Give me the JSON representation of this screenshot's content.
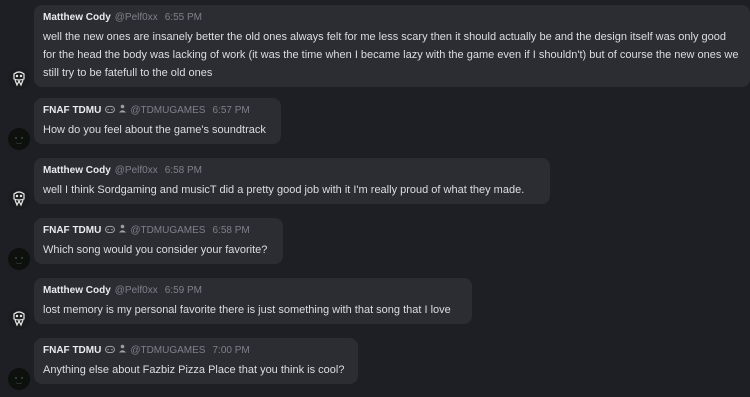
{
  "messages": [
    {
      "user": "Matthew Cody",
      "handle": "@Pelf0xx",
      "time": "6:55 PM",
      "avatar_icon": "skull-doodle-icon",
      "text": "well the new ones are insanely better the old ones always felt for me less scary then it should actually be and the design itself was only good for the head the body was lacking of work (it was the time when I became lazy with the game even if I shouldn't) but of course the new ones we still try to be fatefull to the old ones"
    },
    {
      "user": "FNAF TDMU",
      "handle": "@TDMUGAMES",
      "time": "6:57 PM",
      "avatar_icon": "dark-animatronic-icon",
      "badges": [
        "controller-badge-icon",
        "bot-badge-icon"
      ],
      "text": "How do you feel about the game's soundtrack"
    },
    {
      "user": "Matthew Cody",
      "handle": "@Pelf0xx",
      "time": "6:58 PM",
      "avatar_icon": "skull-doodle-icon",
      "text": "well I think Sordgaming and musicT did a pretty good job with it I'm really proud of what they made."
    },
    {
      "user": "FNAF TDMU",
      "handle": "@TDMUGAMES",
      "time": "6:58 PM",
      "avatar_icon": "dark-animatronic-icon",
      "badges": [
        "controller-badge-icon",
        "bot-badge-icon"
      ],
      "text": "Which song would you consider your favorite?"
    },
    {
      "user": "Matthew Cody",
      "handle": "@Pelf0xx",
      "time": "6:59 PM",
      "avatar_icon": "skull-doodle-icon",
      "text": "lost memory is my personal favorite there is just something with that song that I love"
    },
    {
      "user": "FNAF TDMU",
      "handle": "@TDMUGAMES",
      "time": "7:00 PM",
      "avatar_icon": "dark-animatronic-icon",
      "badges": [
        "controller-badge-icon",
        "bot-badge-icon"
      ],
      "text": "Anything else about Fazbiz Pizza Place that you think is cool?"
    }
  ],
  "colors": {
    "background": "#1e1f24",
    "bubble": "#2b2d33",
    "username": "#e9eaee",
    "meta": "#7e818a",
    "text": "#dcdde1"
  }
}
